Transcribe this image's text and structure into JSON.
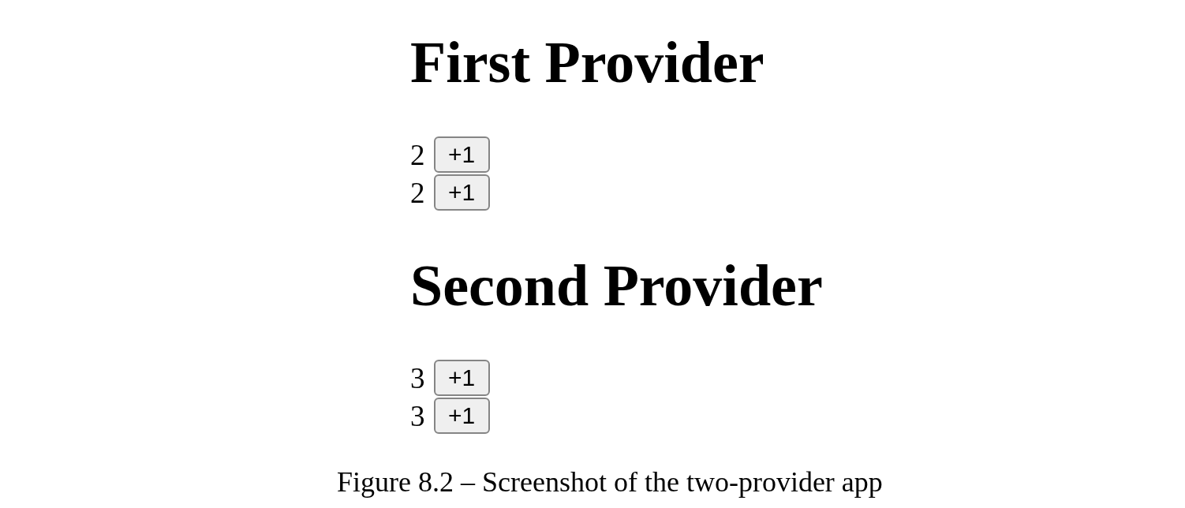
{
  "providers": [
    {
      "title": "First Provider",
      "counters": [
        {
          "value": "2",
          "button": "+1"
        },
        {
          "value": "2",
          "button": "+1"
        }
      ]
    },
    {
      "title": "Second Provider",
      "counters": [
        {
          "value": "3",
          "button": "+1"
        },
        {
          "value": "3",
          "button": "+1"
        }
      ]
    }
  ],
  "caption": "Figure 8.2 – Screenshot of the two-provider app"
}
